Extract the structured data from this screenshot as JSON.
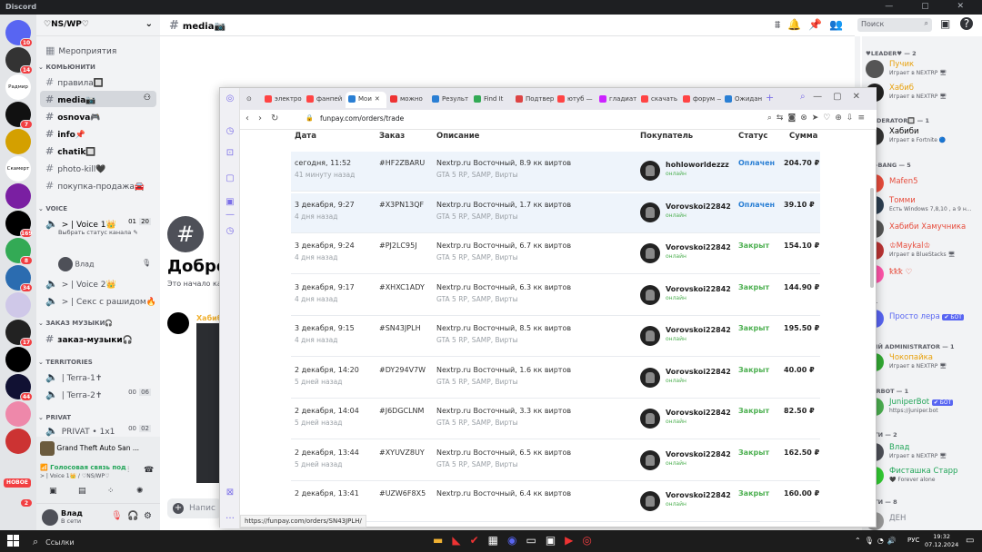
{
  "window": {
    "title": "Discord",
    "controls": "—  ▢  ✕"
  },
  "guilds": [
    {
      "label": "",
      "badge": "10",
      "color": "#5865f2"
    },
    {
      "label": "",
      "badge": "14",
      "color": "#333"
    },
    {
      "label": "Радмир",
      "badge": "",
      "color": "#fff"
    },
    {
      "label": "",
      "badge": "7",
      "color": "#111"
    },
    {
      "label": "",
      "badge": "",
      "color": "#d4a000"
    },
    {
      "label": "Скамерт",
      "badge": "",
      "color": "#fff"
    },
    {
      "label": "",
      "badge": "",
      "color": "#7a1fa2"
    },
    {
      "label": "",
      "badge": "169",
      "color": "#000"
    },
    {
      "label": "",
      "badge": "8",
      "color": "#3a5"
    },
    {
      "label": "",
      "badge": "34",
      "color": "#2b6cb0"
    },
    {
      "label": "",
      "badge": "",
      "color": "#cfc8e8"
    },
    {
      "label": "",
      "badge": "17",
      "color": "#222"
    },
    {
      "label": "",
      "badge": "",
      "color": "#000"
    },
    {
      "label": "",
      "badge": "44",
      "color": "#113"
    },
    {
      "label": "",
      "badge": "",
      "color": "#e8a"
    },
    {
      "label": "",
      "badge": "",
      "color": "#c33"
    }
  ],
  "guild_new_label": "НОВОЕ",
  "guild_new_badge": "2",
  "server": {
    "name": "♡NS/WP♡"
  },
  "channels": {
    "events": "Мероприятия",
    "cat_community": "КОМЬЮНИТИ",
    "rules": "правила🔲",
    "media": "media📷",
    "osnova": "osnova🎮",
    "info": "info📌",
    "chatik": "chatik🔲",
    "photo_kill": "photo-kill🖤",
    "sale": "покупка-продажа🚘",
    "cat_voice": "VOICE",
    "voice1": "> | Voice 1👑",
    "voice1_count": "01",
    "voice1_limit": "20",
    "voice1_status": "Выбрать статус канала ✎",
    "voice1_user": "Влад",
    "voice2": "> | Voice 2👑",
    "voice3": "> | Секс с рашидом🔥",
    "cat_music": "ЗАКАЗ МУЗЫКИ🎧",
    "music": "заказ-музыки🎧",
    "cat_territories": "TERRITORIES",
    "terra1": "| Terra-1✝",
    "terra2": "| Terra-2✝",
    "terra2_count": "00",
    "terra2_limit": "06",
    "cat_private": "PRIVAT",
    "private1": "PRIVAT • 1x1",
    "private1_count": "00",
    "private1_limit": "02"
  },
  "activity": {
    "game": "Grand Theft Auto San ..."
  },
  "voice_panel": {
    "status": "Голосовая связь под",
    "sub": "> | Voice 1👑 / ♡NS/WP♡"
  },
  "user_panel": {
    "name": "Влад",
    "status": "В сети"
  },
  "main": {
    "channel_title": "media📷",
    "welcome_title": "Добро",
    "welcome_sub": "Это начало ка",
    "msg_author": "Хабиб",
    "input_placeholder": "Напис",
    "search_placeholder": "Поиск"
  },
  "members": {
    "cat_leader": "♥LEADER♥ — 2",
    "m1_name": "Пучик",
    "m1_status": "Играет в NEXTRP 🖥",
    "m2_name": "Хабиб",
    "m2_status": "Играет в NEXTRP 🖥",
    "cat_moderator": "MODERATOR🔲 — 1",
    "m3_name": "Хабиби",
    "m3_status": "Играет в Fortnite 🔵",
    "cat_bang": "NG-BANG — 5",
    "m4_name": "Mafen5",
    "m5_name": "Томми",
    "m5_status": "Есть Windows 7,8,10 , а 9 н...",
    "m6_name": "Хабиби Хамучника",
    "m7_name": "♔Maykal♔",
    "m7_status": "Играет в BlueStacks 🖥",
    "m8_name": "ꝁꝁꝁ ♡",
    "cat_1": "— 1",
    "m9_name": "Просто лера",
    "m9_badge": "✔ БОТ",
    "cat_admin": "ШИЙ ADMINISTRATOR — 1",
    "m10_name": "Чокопайка",
    "m10_status": "Играет в NEXTRP 🖥",
    "cat_juniper": "IPERBOT — 1",
    "m11_name": "JuniperBot",
    "m11_badge": "✔ БОТ",
    "m11_status": "https://juniper.bot",
    "cat_seti2": "СЕТИ — 2",
    "m12_name": "Влад",
    "m12_status": "Играет в NEXTRP 🖥",
    "m13_name": "Фисташка Старр",
    "m13_status": "🖤 Forever alone",
    "cat_seti8": "СЕТИ — 8",
    "m14_name": "ДЕН"
  },
  "browser": {
    "tabs": [
      "электро",
      "фанпей",
      "Мои",
      "можно",
      "Результ",
      "Find It",
      "Подтвер",
      "ютуб —",
      "гладиат",
      "скачать",
      "форум —",
      "Ожидан"
    ],
    "url": "funpay.com/orders/trade",
    "status_url": "https://funpay.com/orders/SN43JPLH/",
    "headers": {
      "date": "Дата",
      "order": "Заказ",
      "desc": "Описание",
      "buyer": "Покупатель",
      "status": "Статус",
      "sum": "Сумма"
    },
    "orders": [
      {
        "date": "сегодня, 11:52",
        "ago": "41 минуту назад",
        "id": "#HF2ZBARU",
        "desc": "Nextrp.ru Восточный, 8.9 кк виртов",
        "game": "GTA 5 RP, SAMP, Вирты",
        "buyer": "hohloworldezzz",
        "online": "онлайн",
        "status": "Оплачен",
        "status_color": "#2a7fd4",
        "sum": "204.70 ₽",
        "highlight": true
      },
      {
        "date": "3 декабря, 9:27",
        "ago": "4 дня назад",
        "id": "#X3PN13QF",
        "desc": "Nextrp.ru Восточный, 1.7 кк виртов",
        "game": "GTA 5 RP, SAMP, Вирты",
        "buyer": "Vorovskoi22842",
        "online": "онлайн",
        "status": "Оплачен",
        "status_color": "#2a7fd4",
        "sum": "39.10 ₽",
        "highlight": true
      },
      {
        "date": "3 декабря, 9:24",
        "ago": "4 дня назад",
        "id": "#PJ2LC95J",
        "desc": "Nextrp.ru Восточный, 6.7 кк виртов",
        "game": "GTA 5 RP, SAMP, Вирты",
        "buyer": "Vorovskoi22842",
        "online": "онлайн",
        "status": "Закрыт",
        "status_color": "#4caf50",
        "sum": "154.10 ₽",
        "highlight": false
      },
      {
        "date": "3 декабря, 9:17",
        "ago": "4 дня назад",
        "id": "#XHXC1ADY",
        "desc": "Nextrp.ru Восточный, 6.3 кк виртов",
        "game": "GTA 5 RP, SAMP, Вирты",
        "buyer": "Vorovskoi22842",
        "online": "онлайн",
        "status": "Закрыт",
        "status_color": "#4caf50",
        "sum": "144.90 ₽",
        "highlight": false
      },
      {
        "date": "3 декабря, 9:15",
        "ago": "4 дня назад",
        "id": "#SN43JPLH",
        "desc": "Nextrp.ru Восточный, 8.5 кк виртов",
        "game": "GTA 5 RP, SAMP, Вирты",
        "buyer": "Vorovskoi22842",
        "online": "онлайн",
        "status": "Закрыт",
        "status_color": "#4caf50",
        "sum": "195.50 ₽",
        "highlight": false
      },
      {
        "date": "2 декабря, 14:20",
        "ago": "5 дней назад",
        "id": "#DY294V7W",
        "desc": "Nextrp.ru Восточный, 1.6 кк виртов",
        "game": "GTA 5 RP, SAMP, Вирты",
        "buyer": "Vorovskoi22842",
        "online": "онлайн",
        "status": "Закрыт",
        "status_color": "#4caf50",
        "sum": "40.00 ₽",
        "highlight": false
      },
      {
        "date": "2 декабря, 14:04",
        "ago": "5 дней назад",
        "id": "#J6DGCLNM",
        "desc": "Nextrp.ru Восточный, 3.3 кк виртов",
        "game": "GTA 5 RP, SAMP, Вирты",
        "buyer": "Vorovskoi22842",
        "online": "онлайн",
        "status": "Закрыт",
        "status_color": "#4caf50",
        "sum": "82.50 ₽",
        "highlight": false
      },
      {
        "date": "2 декабря, 13:44",
        "ago": "5 дней назад",
        "id": "#XYUVZ8UY",
        "desc": "Nextrp.ru Восточный, 6.5 кк виртов",
        "game": "GTA 5 RP, SAMP, Вирты",
        "buyer": "Vorovskoi22842",
        "online": "онлайн",
        "status": "Закрыт",
        "status_color": "#4caf50",
        "sum": "162.50 ₽",
        "highlight": false
      },
      {
        "date": "2 декабря, 13:41",
        "ago": "",
        "id": "#UZW6F8X5",
        "desc": "Nextrp.ru Восточный, 6.4 кк виртов",
        "game": "",
        "buyer": "Vorovskoi22842",
        "online": "онлайн",
        "status": "Закрыт",
        "status_color": "#4caf50",
        "sum": "160.00 ₽",
        "highlight": false
      }
    ]
  },
  "taskbar": {
    "search": "Ссылки",
    "lang": "РУС",
    "time": "19:32",
    "date": "07.12.2024"
  }
}
